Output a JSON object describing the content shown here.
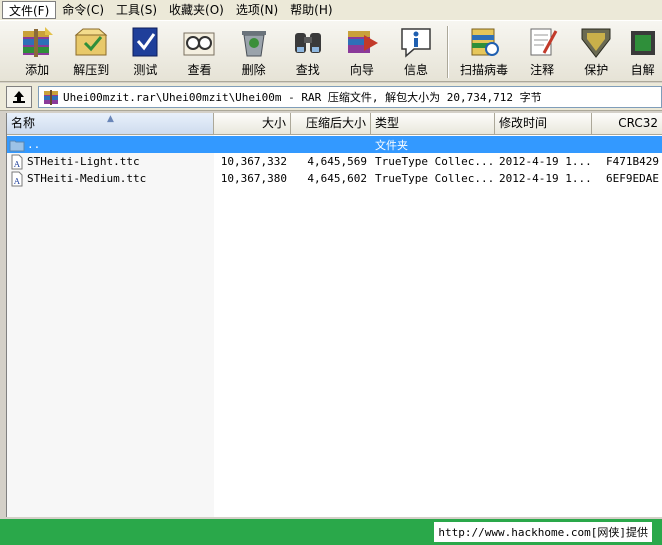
{
  "menu": [
    {
      "label": "文件(F)"
    },
    {
      "label": "命令(C)"
    },
    {
      "label": "工具(S)"
    },
    {
      "label": "收藏夹(O)"
    },
    {
      "label": "选项(N)"
    },
    {
      "label": "帮助(H)"
    }
  ],
  "toolbar": [
    {
      "label": "添加",
      "icon": "add-archive-icon"
    },
    {
      "label": "解压到",
      "icon": "extract-to-icon"
    },
    {
      "label": "测试",
      "icon": "test-icon"
    },
    {
      "label": "查看",
      "icon": "view-icon"
    },
    {
      "label": "删除",
      "icon": "delete-icon"
    },
    {
      "label": "查找",
      "icon": "find-icon"
    },
    {
      "label": "向导",
      "icon": "wizard-icon"
    },
    {
      "label": "信息",
      "icon": "info-icon"
    },
    {
      "label": "扫描病毒",
      "icon": "virus-scan-icon"
    },
    {
      "label": "注释",
      "icon": "comment-icon"
    },
    {
      "label": "保护",
      "icon": "protect-icon"
    },
    {
      "label": "自解",
      "icon": "self-extract-icon"
    }
  ],
  "address": {
    "path": "Uhei00mzit.rar\\Uhei00mzit\\Uhei00m - RAR 压缩文件, 解包大小为 20,734,712 字节"
  },
  "columns": {
    "name": "名称",
    "size": "大小",
    "packed": "压缩后大小",
    "type": "类型",
    "modified": "修改时间",
    "crc": "CRC32"
  },
  "rows": [
    {
      "name": "..",
      "size": "",
      "packed": "",
      "type": "文件夹",
      "modified": "",
      "crc": "",
      "kind": "folder",
      "selected": true
    },
    {
      "name": "STHeiti-Light.ttc",
      "size": "10,367,332",
      "packed": "4,645,569",
      "type": "TrueType Collec...",
      "modified": "2012-4-19 1...",
      "crc": "F471B429",
      "kind": "file",
      "selected": false
    },
    {
      "name": "STHeiti-Medium.ttc",
      "size": "10,367,380",
      "packed": "4,645,602",
      "type": "TrueType Collec...",
      "modified": "2012-4-19 1...",
      "crc": "6EF9EDAE",
      "kind": "file",
      "selected": false
    }
  ],
  "status": {
    "text": "http://www.hackhome.com[网侠]提供"
  },
  "colors": {
    "selection": "#3399ff",
    "status_bar": "#2aa84a"
  }
}
